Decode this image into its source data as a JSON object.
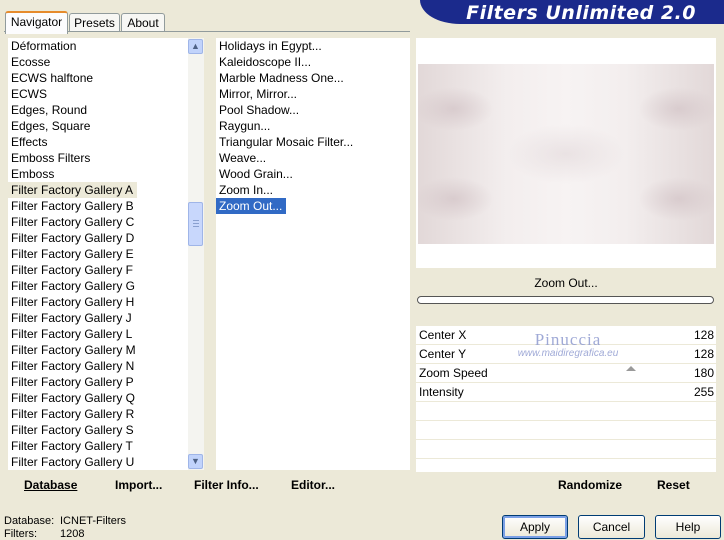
{
  "title": "Filters Unlimited 2.0",
  "tabs": [
    "Navigator",
    "Presets",
    "About"
  ],
  "categories": [
    "Déformation",
    "Ecosse",
    "ECWS halftone",
    "ECWS",
    "Edges, Round",
    "Edges, Square",
    "Effects",
    "Emboss Filters",
    "Emboss",
    "Filter Factory Gallery A",
    "Filter Factory Gallery B",
    "Filter Factory Gallery C",
    "Filter Factory Gallery D",
    "Filter Factory Gallery E",
    "Filter Factory Gallery F",
    "Filter Factory Gallery G",
    "Filter Factory Gallery H",
    "Filter Factory Gallery J",
    "Filter Factory Gallery L",
    "Filter Factory Gallery M",
    "Filter Factory Gallery N",
    "Filter Factory Gallery P",
    "Filter Factory Gallery Q",
    "Filter Factory Gallery R",
    "Filter Factory Gallery S",
    "Filter Factory Gallery T",
    "Filter Factory Gallery U"
  ],
  "filters": [
    "Holidays in Egypt...",
    "Kaleidoscope II...",
    "Marble Madness One...",
    "Mirror, Mirror...",
    "Pool Shadow...",
    "Raygun...",
    "Triangular Mosaic Filter...",
    "Weave...",
    "Wood Grain...",
    "Zoom In...",
    "Zoom Out..."
  ],
  "selected_filter_name": "Zoom Out...",
  "params": [
    {
      "label": "Center X",
      "value": "128"
    },
    {
      "label": "Center Y",
      "value": "128"
    },
    {
      "label": "Zoom Speed",
      "value": "180"
    },
    {
      "label": "Intensity",
      "value": "255"
    }
  ],
  "watermark": {
    "line1": "Pinuccia",
    "line2": "www.maidiregrafica.eu"
  },
  "actions": {
    "database": "Database",
    "import": "Import...",
    "filter_info": "Filter Info...",
    "editor": "Editor...",
    "randomize": "Randomize",
    "reset": "Reset"
  },
  "status": {
    "database_label": "Database:",
    "database_value": "ICNET-Filters",
    "filters_label": "Filters:",
    "filters_value": "1208"
  },
  "buttons": {
    "apply": "Apply",
    "cancel": "Cancel",
    "help": "Help"
  },
  "colors": {
    "banner": "#1b2a8c",
    "selection": "#316ac5",
    "window_bg": "#ece9d8"
  }
}
